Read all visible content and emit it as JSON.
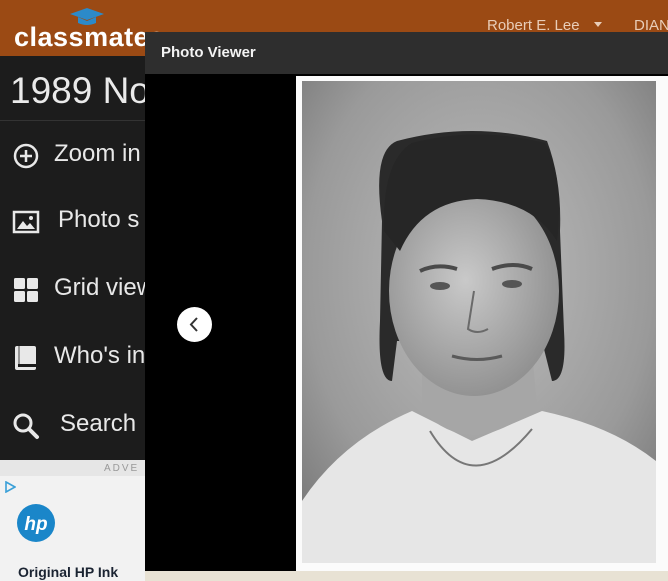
{
  "header": {
    "brand": "classmates",
    "user_name": "Robert E. Lee",
    "extra_user": "DIAN"
  },
  "sidebar": {
    "title": "1989 No",
    "items": [
      {
        "label": "Zoom in",
        "icon": "zoom-in-icon"
      },
      {
        "label": "Photo s",
        "icon": "photo-icon"
      },
      {
        "label": "Grid view",
        "icon": "grid-icon"
      },
      {
        "label": "Who's in",
        "icon": "book-icon"
      },
      {
        "label": "Search",
        "icon": "search-icon"
      }
    ]
  },
  "ad": {
    "label": "ADVE",
    "headline": "Original HP Ink"
  },
  "modal": {
    "title": "Photo Viewer",
    "prev_icon": "chevron-left-icon"
  },
  "colors": {
    "header_bg": "#9b4a14",
    "sidebar_bg": "#1c1c1c",
    "modal_header_bg": "#2e2e2e"
  }
}
